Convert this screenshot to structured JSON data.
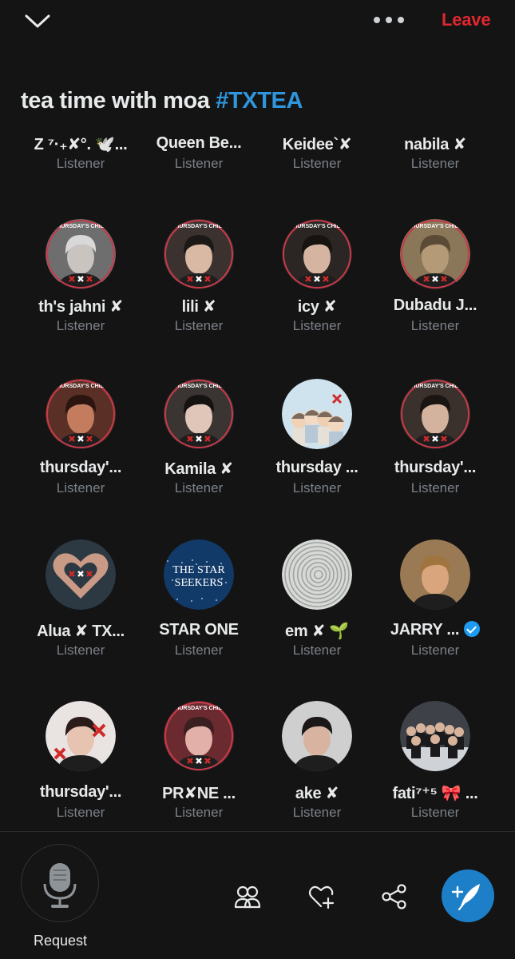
{
  "header": {
    "leave_label": "Leave"
  },
  "space": {
    "title": "tea time with moa",
    "hashtag": "#TXTEA"
  },
  "listeners": [
    {
      "name": "Z ⁷·₊✘°. 🕊️...",
      "role": "Listener"
    },
    {
      "name": "Queen Be...",
      "role": "Listener"
    },
    {
      "name": "Keidee`✘",
      "role": "Listener"
    },
    {
      "name": "nabila ✘",
      "role": "Listener"
    },
    {
      "name": "th's jahni ✘",
      "role": "Listener"
    },
    {
      "name": "lili ✘",
      "role": "Listener"
    },
    {
      "name": "icy ✘",
      "role": "Listener"
    },
    {
      "name": "Dubadu J...",
      "role": "Listener"
    },
    {
      "name": "thursday'...",
      "role": "Listener"
    },
    {
      "name": "Kamila ✘",
      "role": "Listener"
    },
    {
      "name": "thursday ...",
      "role": "Listener"
    },
    {
      "name": "thursday'...",
      "role": "Listener"
    },
    {
      "name": "Alua ✘ TX...",
      "role": "Listener"
    },
    {
      "name": "STAR ONE",
      "role": "Listener"
    },
    {
      "name": "em ✘ 🌱",
      "role": "Listener"
    },
    {
      "name": "JARRY ...",
      "role": "Listener",
      "verified": true
    },
    {
      "name": "thursday'...",
      "role": "Listener"
    },
    {
      "name": "PR✘NE ...",
      "role": "Listener"
    },
    {
      "name": "ake ✘",
      "role": "Listener"
    },
    {
      "name": "fati⁷⁺⁵ 🎀 ...",
      "role": "Listener"
    }
  ],
  "avatar_texts": {
    "frame_label": "THURSDAY'S CHILD",
    "star_seekers_line1": "THE STAR",
    "star_seekers_line2": "SEEKERS"
  },
  "bottombar": {
    "request_label": "Request"
  },
  "colors": {
    "accent": "#1d9bf0",
    "leave": "#e0272f",
    "hashtag": "#2f95dc"
  }
}
